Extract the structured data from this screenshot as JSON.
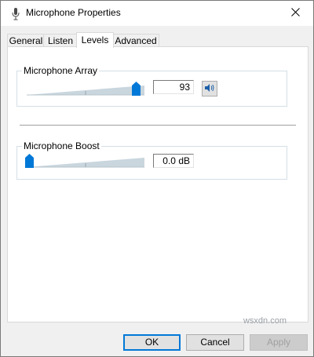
{
  "window": {
    "title": "Microphone Properties",
    "app_icon": "microphone-icon",
    "close_icon": "close-icon"
  },
  "tabs": [
    {
      "label": "General",
      "active": false
    },
    {
      "label": "Listen",
      "active": false
    },
    {
      "label": "Levels",
      "active": true
    },
    {
      "label": "Advanced",
      "active": false
    }
  ],
  "levels": {
    "microphone_array": {
      "label": "Microphone Array",
      "value": "93",
      "level_fraction": 0.93,
      "speaker_icon": "speaker-icon"
    },
    "microphone_boost": {
      "label": "Microphone Boost",
      "value": "0.0 dB",
      "level_fraction": 0.0
    }
  },
  "buttons": {
    "ok": "OK",
    "cancel": "Cancel",
    "apply": "Apply"
  },
  "watermark": "wsxdn.com",
  "colors": {
    "accent": "#0078d7",
    "track": "#c9d6de"
  }
}
